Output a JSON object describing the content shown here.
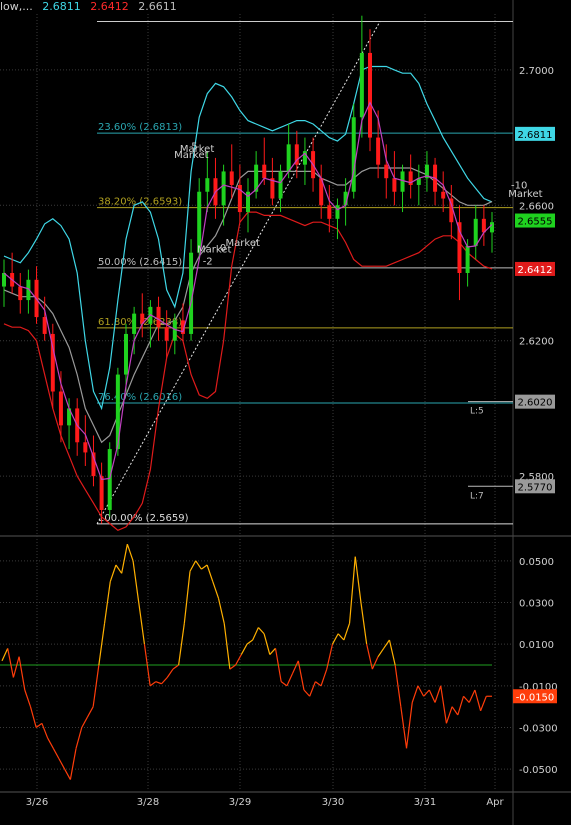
{
  "header": {
    "title": "low,...",
    "values": [
      {
        "text": "2.6811",
        "color": "#3fd7e6"
      },
      {
        "text": "2.6412",
        "color": "#ff2a2a"
      },
      {
        "text": "2.6611",
        "color": "#bdbdbd"
      }
    ]
  },
  "chart_data": [
    {
      "type": "candlestick",
      "panel": "price",
      "x_ticks": [
        "3/26",
        "3/28",
        "3/29",
        "3/30",
        "3/31",
        "Apr"
      ],
      "y_ticks": [
        "2.7000",
        "2.6600",
        "2.6200",
        "2.5800"
      ],
      "ylim": [
        2.5635,
        2.7165
      ],
      "grid": true,
      "colors": {
        "up": "#1fd21f",
        "down": "#ff1a1a",
        "upper_band": "#3fd7e6",
        "lower_band": "#e01b1b",
        "mid_band": "#9a9a9a",
        "ma": "#c040c0"
      },
      "fibonacci": [
        {
          "label": "23.60% (2.6813)",
          "value": 2.6813,
          "color": "#2aa6b0"
        },
        {
          "label": "38.20% (2.6593)",
          "value": 2.6593,
          "color": "#b0a020"
        },
        {
          "label": "50.00% (2.6415)",
          "value": 2.6415,
          "color": "#bdbdbd"
        },
        {
          "label": "61.80% (2.6238)",
          "value": 2.6238,
          "color": "#b0a020"
        },
        {
          "label": "76.40% (2.6016)",
          "value": 2.6016,
          "color": "#2aa6b0"
        },
        {
          "label": "100.00% (2.5659)",
          "value": 2.5659,
          "color": "#dddddd"
        }
      ],
      "fib_top": 2.7143,
      "price_tags": [
        {
          "text": "2.6811",
          "value": 2.6811,
          "bg": "#3fd7e6",
          "fg": "#000000"
        },
        {
          "text": "2.6555",
          "value": 2.6555,
          "bg": "#1fd21f",
          "fg": "#000000"
        },
        {
          "text": "2.6412",
          "value": 2.6412,
          "bg": "#e01b1b",
          "fg": "#ffffff"
        },
        {
          "text": "2.6020",
          "value": 2.602,
          "bg": "#9a9a9a",
          "fg": "#000000"
        },
        {
          "text": "2.5770",
          "value": 2.577,
          "bg": "#9a9a9a",
          "fg": "#000000"
        }
      ],
      "levels": [
        {
          "label": "L:5",
          "value": 2.602
        },
        {
          "label": "L:7",
          "value": 2.577
        }
      ],
      "annotations": [
        {
          "text": "Market",
          "x": 0.315,
          "value": 2.6758
        },
        {
          "text": "Market",
          "x": 0.305,
          "value": 2.674
        },
        {
          "text": "5",
          "x": 0.335,
          "value": 2.6765
        },
        {
          "text": "Market",
          "x": 0.345,
          "value": 2.646
        },
        {
          "text": "-2",
          "x": 0.355,
          "value": 2.6425
        },
        {
          "text": "Market",
          "x": 0.395,
          "value": 2.648
        },
        {
          "text": "0",
          "x": 0.385,
          "value": 2.6465
        },
        {
          "text": "-10",
          "x": 0.895,
          "value": 2.665
        },
        {
          "text": "Market",
          "x": 0.89,
          "value": 2.6625
        }
      ]
    },
    {
      "type": "line",
      "panel": "oscillator",
      "y_ticks": [
        "0.0500",
        "0.0300",
        "0.0100",
        "-0.0100",
        "-0.0300",
        "-0.0500"
      ],
      "ylim": [
        -0.06,
        0.06
      ],
      "zero_line": 0.0,
      "last_value": {
        "text": "-0.0150",
        "value": -0.015
      },
      "values": [
        0.002,
        0.008,
        -0.006,
        0.004,
        -0.012,
        -0.02,
        -0.03,
        -0.028,
        -0.035,
        -0.04,
        -0.045,
        -0.05,
        -0.055,
        -0.04,
        -0.03,
        -0.025,
        -0.02,
        0.0,
        0.02,
        0.04,
        0.048,
        0.044,
        0.058,
        0.05,
        0.03,
        0.01,
        -0.01,
        -0.008,
        -0.009,
        -0.006,
        -0.002,
        0.0,
        0.02,
        0.045,
        0.05,
        0.046,
        0.048,
        0.04,
        0.032,
        0.02,
        -0.002,
        0.0,
        0.005,
        0.01,
        0.012,
        0.018,
        0.015,
        0.005,
        0.008,
        -0.008,
        -0.01,
        -0.004,
        0.002,
        -0.012,
        -0.015,
        -0.008,
        -0.01,
        -0.002,
        0.01,
        0.015,
        0.012,
        0.02,
        0.052,
        0.03,
        0.01,
        -0.002,
        0.004,
        0.008,
        0.012,
        0.0,
        -0.02,
        -0.04,
        -0.018,
        -0.01,
        -0.015,
        -0.012,
        -0.018,
        -0.01,
        -0.028,
        -0.02,
        -0.024,
        -0.015,
        -0.018,
        -0.012,
        -0.022,
        -0.015,
        -0.015
      ],
      "color_high": "#ffb000",
      "color_low": "#ff3d0a"
    }
  ],
  "candles": [
    [
      2.636,
      2.644,
      2.63,
      2.64
    ],
    [
      2.64,
      2.646,
      2.634,
      2.636
    ],
    [
      2.636,
      2.64,
      2.628,
      2.632
    ],
    [
      2.632,
      2.641,
      2.628,
      2.638
    ],
    [
      2.638,
      2.642,
      2.625,
      2.627
    ],
    [
      2.627,
      2.633,
      2.62,
      2.622
    ],
    [
      2.622,
      2.625,
      2.6,
      2.605
    ],
    [
      2.605,
      2.611,
      2.59,
      2.595
    ],
    [
      2.595,
      2.603,
      2.588,
      2.6
    ],
    [
      2.6,
      2.603,
      2.586,
      2.59
    ],
    [
      2.59,
      2.598,
      2.583,
      2.587
    ],
    [
      2.587,
      2.592,
      2.577,
      2.58
    ],
    [
      2.58,
      2.584,
      2.566,
      2.57
    ],
    [
      2.57,
      2.59,
      2.568,
      2.588
    ],
    [
      2.588,
      2.612,
      2.586,
      2.61
    ],
    [
      2.61,
      2.625,
      2.605,
      2.622
    ],
    [
      2.622,
      2.63,
      2.616,
      2.628
    ],
    [
      2.628,
      2.634,
      2.621,
      2.625
    ],
    [
      2.625,
      2.632,
      2.618,
      2.63
    ],
    [
      2.63,
      2.633,
      2.62,
      2.624
    ],
    [
      2.624,
      2.629,
      2.615,
      2.62
    ],
    [
      2.62,
      2.628,
      2.616,
      2.626
    ],
    [
      2.626,
      2.631,
      2.62,
      2.622
    ],
    [
      2.622,
      2.65,
      2.62,
      2.646
    ],
    [
      2.646,
      2.668,
      2.644,
      2.664
    ],
    [
      2.664,
      2.676,
      2.658,
      2.668
    ],
    [
      2.668,
      2.674,
      2.656,
      2.66
    ],
    [
      2.66,
      2.672,
      2.654,
      2.67
    ],
    [
      2.67,
      2.678,
      2.662,
      2.666
    ],
    [
      2.666,
      2.672,
      2.655,
      2.658
    ],
    [
      2.658,
      2.668,
      2.652,
      2.664
    ],
    [
      2.664,
      2.676,
      2.662,
      2.672
    ],
    [
      2.672,
      2.68,
      2.666,
      2.668
    ],
    [
      2.668,
      2.674,
      2.66,
      2.662
    ],
    [
      2.662,
      2.672,
      2.658,
      2.67
    ],
    [
      2.67,
      2.684,
      2.668,
      2.678
    ],
    [
      2.678,
      2.682,
      2.668,
      2.672
    ],
    [
      2.672,
      2.68,
      2.666,
      2.676
    ],
    [
      2.676,
      2.68,
      2.664,
      2.668
    ],
    [
      2.668,
      2.672,
      2.656,
      2.66
    ],
    [
      2.66,
      2.666,
      2.652,
      2.656
    ],
    [
      2.656,
      2.662,
      2.65,
      2.66
    ],
    [
      2.66,
      2.668,
      2.654,
      2.664
    ],
    [
      2.664,
      2.69,
      2.662,
      2.686
    ],
    [
      2.686,
      2.716,
      2.68,
      2.705
    ],
    [
      2.705,
      2.712,
      2.676,
      2.68
    ],
    [
      2.68,
      2.688,
      2.668,
      2.672
    ],
    [
      2.672,
      2.678,
      2.662,
      2.668
    ],
    [
      2.668,
      2.676,
      2.66,
      2.664
    ],
    [
      2.664,
      2.672,
      2.658,
      2.67
    ],
    [
      2.67,
      2.675,
      2.662,
      2.666
    ],
    [
      2.666,
      2.672,
      2.66,
      2.668
    ],
    [
      2.668,
      2.676,
      2.664,
      2.672
    ],
    [
      2.672,
      2.674,
      2.66,
      2.664
    ],
    [
      2.664,
      2.67,
      2.658,
      2.662
    ],
    [
      2.662,
      2.666,
      2.65,
      2.655
    ],
    [
      2.655,
      2.66,
      2.632,
      2.64
    ],
    [
      2.64,
      2.65,
      2.636,
      2.648
    ],
    [
      2.648,
      2.66,
      2.644,
      2.656
    ],
    [
      2.656,
      2.66,
      2.648,
      2.652
    ],
    [
      2.652,
      2.658,
      2.646,
      2.655
    ]
  ],
  "bands": {
    "upper": [
      2.645,
      2.644,
      2.643,
      2.646,
      2.65,
      2.6545,
      2.656,
      2.654,
      2.65,
      2.64,
      2.62,
      2.605,
      2.6,
      2.612,
      2.632,
      2.65,
      2.66,
      2.661,
      2.658,
      2.65,
      2.635,
      2.63,
      2.64,
      2.67,
      2.686,
      2.693,
      2.696,
      2.695,
      2.692,
      2.688,
      2.685,
      2.684,
      2.683,
      2.682,
      2.683,
      2.684,
      2.685,
      2.685,
      2.684,
      2.682,
      2.68,
      2.679,
      2.681,
      2.69,
      2.7,
      2.701,
      2.701,
      2.701,
      2.7,
      2.699,
      2.699,
      2.696,
      2.69,
      2.685,
      2.68,
      2.676,
      2.672,
      2.668,
      2.665,
      2.662,
      2.661
    ],
    "lower": [
      2.625,
      2.624,
      2.624,
      2.623,
      2.62,
      2.61,
      2.6,
      2.592,
      2.586,
      2.58,
      2.576,
      2.572,
      2.568,
      2.566,
      2.564,
      2.565,
      2.568,
      2.572,
      2.582,
      2.6,
      2.615,
      2.622,
      2.62,
      2.61,
      2.604,
      2.603,
      2.605,
      2.62,
      2.642,
      2.655,
      2.658,
      2.658,
      2.657,
      2.657,
      2.657,
      2.656,
      2.655,
      2.654,
      2.655,
      2.655,
      2.654,
      2.653,
      2.649,
      2.644,
      2.642,
      2.642,
      2.642,
      2.642,
      2.643,
      2.644,
      2.645,
      2.646,
      2.648,
      2.65,
      2.651,
      2.651,
      2.649,
      2.646,
      2.644,
      2.642,
      2.6412
    ],
    "mid": [
      2.635,
      2.634,
      2.633,
      2.633,
      2.633,
      2.631,
      2.628,
      2.623,
      2.618,
      2.61,
      2.6,
      2.595,
      2.59,
      2.592,
      2.598,
      2.604,
      2.61,
      2.615,
      2.62,
      2.625,
      2.625,
      2.626,
      2.63,
      2.64,
      2.645,
      2.648,
      2.651,
      2.656,
      2.662,
      2.668,
      2.67,
      2.67,
      2.67,
      2.67,
      2.67,
      2.67,
      2.67,
      2.67,
      2.67,
      2.668,
      2.667,
      2.666,
      2.666,
      2.668,
      2.67,
      2.671,
      2.671,
      2.671,
      2.671,
      2.671,
      2.671,
      2.67,
      2.669,
      2.667,
      2.665,
      2.663,
      2.661,
      2.66,
      2.66,
      2.66,
      2.6611
    ]
  }
}
